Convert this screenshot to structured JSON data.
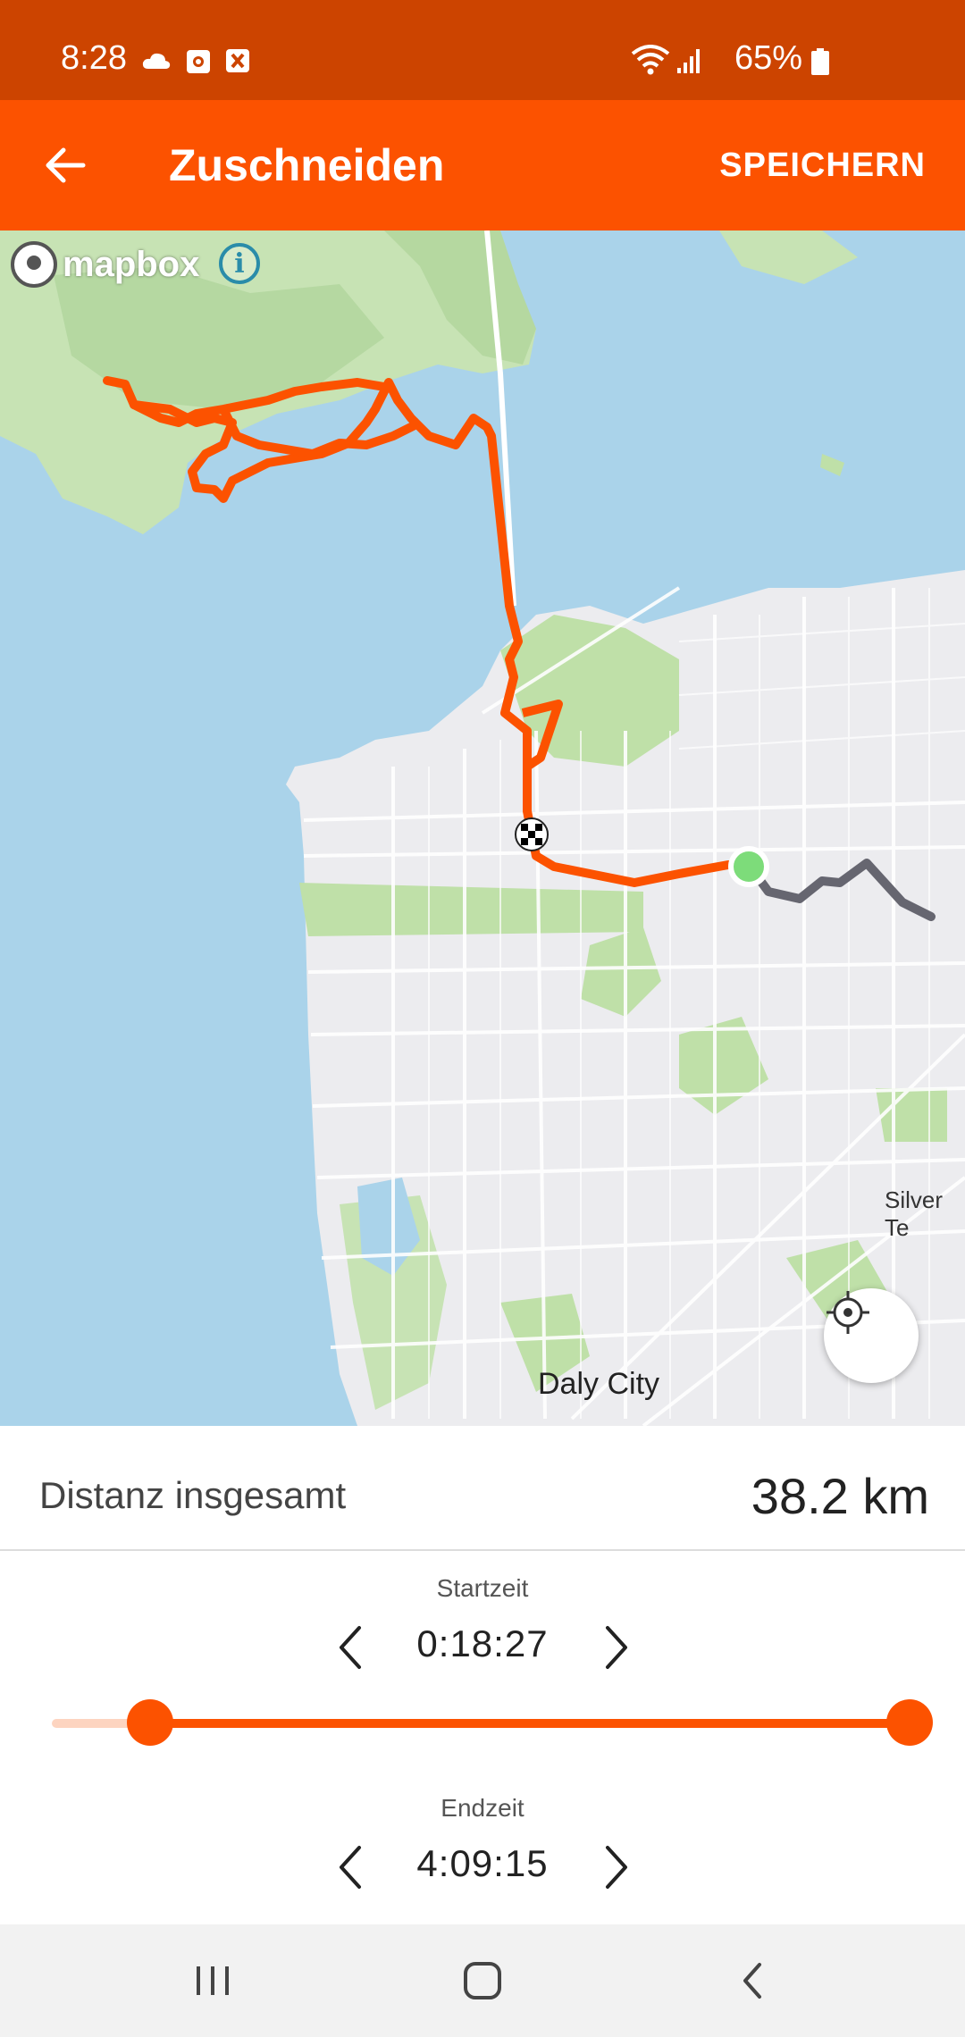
{
  "status_bar": {
    "time": "8:28",
    "battery": "65%"
  },
  "app_bar": {
    "title": "Zuschneiden",
    "save_label": "SPEICHERN"
  },
  "map": {
    "attribution": "mapbox",
    "labels": {
      "daly_city": "Daly City",
      "silver_terrace": "Silver Te"
    }
  },
  "summary": {
    "distance_label": "Distanz insgesamt",
    "distance_value": "38.2 km"
  },
  "start_time": {
    "label": "Startzeit",
    "value": "0:18:27"
  },
  "end_time": {
    "label": "Endzeit",
    "value": "4:09:15"
  },
  "colors": {
    "accent": "#fc5200",
    "status_bar": "#cc4400",
    "route_trimmed": "#666670",
    "start_marker": "#7ddc7a"
  }
}
